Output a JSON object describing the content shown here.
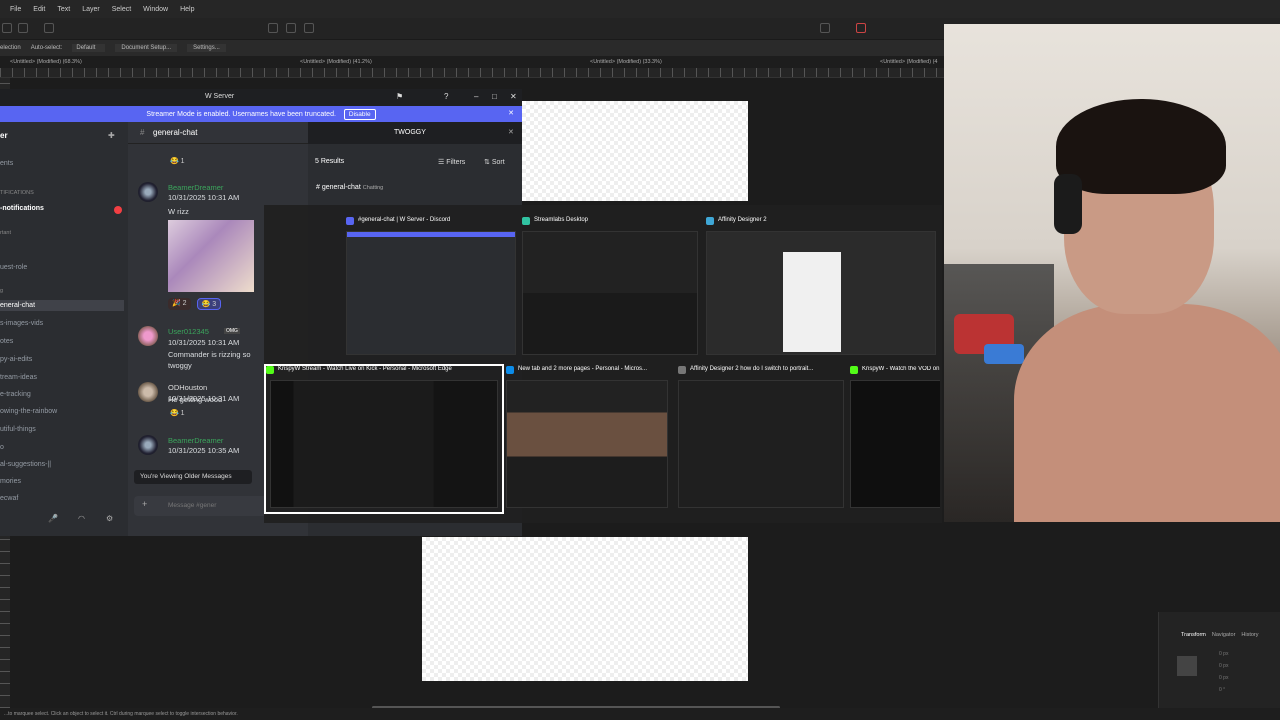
{
  "affinity": {
    "menu": [
      "File",
      "Edit",
      "Text",
      "Layer",
      "Select",
      "Window",
      "Help"
    ],
    "context": {
      "selection": "election",
      "auto_select_label": "Auto-select:",
      "auto_select_value": "Default",
      "document_setup": "Document Setup...",
      "settings": "Settings..."
    },
    "doc_tabs": [
      "<Untitled> (Modified) (68.3%)",
      "<Untitled> (Modified) (41.2%)",
      "<Untitled> (Modified) (33.3%)",
      "<Untitled> (Modified) (4"
    ],
    "panel_tabs": [
      "Transform",
      "Navigator",
      "History"
    ],
    "transform_values": [
      "0 px",
      "0 px",
      "0 px",
      "0 px",
      "0 °"
    ],
    "status": "...to marquee select. Click an object to select it. Ctrl during marquee select to toggle intersection behavior."
  },
  "discord": {
    "window_title": "W Server",
    "streamer_banner": "Streamer Mode is enabled. Usernames have been truncated.",
    "disable_label": "Disable",
    "server_name": "er",
    "channel": "general-chat",
    "sidebar": [
      {
        "label": "ents",
        "type": "channel"
      },
      {
        "label": "TIFICATIONS",
        "type": "category"
      },
      {
        "label": "-notifications",
        "type": "channel",
        "bold": true
      },
      {
        "label": "rtant",
        "type": "category"
      },
      {
        "label": "uest-role",
        "type": "channel"
      },
      {
        "label": "g",
        "type": "category"
      },
      {
        "label": "eneral-chat",
        "type": "active"
      },
      {
        "label": "s-images-vids",
        "type": "channel"
      },
      {
        "label": "otes",
        "type": "channel"
      },
      {
        "label": "py-ai-edits",
        "type": "channel"
      },
      {
        "label": "tream-ideas",
        "type": "channel"
      },
      {
        "label": "e-tracking",
        "type": "channel"
      },
      {
        "label": "owing-the-rainbow",
        "type": "channel"
      },
      {
        "label": "utiful-things",
        "type": "channel"
      },
      {
        "label": "o",
        "type": "channel"
      },
      {
        "label": "al-suggestions-||",
        "type": "channel"
      },
      {
        "label": "mories",
        "type": "channel"
      },
      {
        "label": "ecwaf",
        "type": "channel"
      }
    ],
    "messages": [
      {
        "user": "BeamerDreamer",
        "time": "10/31/2025 10:31 AM",
        "text": "W rizz",
        "reacts": [
          "2",
          "3"
        ]
      },
      {
        "user": "User012345",
        "time": "10/31/2025 10:31 AM",
        "badge": "OMG",
        "text": "Commander is rizzing so",
        "text2": "twoggy"
      },
      {
        "user": "ODHouston",
        "time": "10/31/2025 10:31 AM",
        "text": "He getting wood",
        "reacts": [
          "1"
        ]
      },
      {
        "user": "BeamerDreamer",
        "time": "10/31/2025 10:35 AM",
        "text": ""
      }
    ],
    "older_messages": "You're Viewing Older Messages",
    "message_placeholder": "Message #gener",
    "search_query": "TWOGGY",
    "results": "5 Results",
    "filters": "Filters",
    "sort": "Sort",
    "result_channel": "general-chat",
    "result_category": "Chatting",
    "top_react": "1"
  },
  "switcher": {
    "windows": [
      {
        "title": "#general-chat | W Server - Discord"
      },
      {
        "title": "Streamlabs Desktop"
      },
      {
        "title": "Affinity Designer 2"
      },
      {
        "title": "KrispyW Stream - Watch Live on Kick - Personal - Microsoft Edge"
      },
      {
        "title": "New tab and 2 more pages - Personal - Micros..."
      },
      {
        "title": "Affinity Designer 2 how do I switch to portrait..."
      },
      {
        "title": "KrispyW - Watch the VOD on"
      }
    ]
  }
}
